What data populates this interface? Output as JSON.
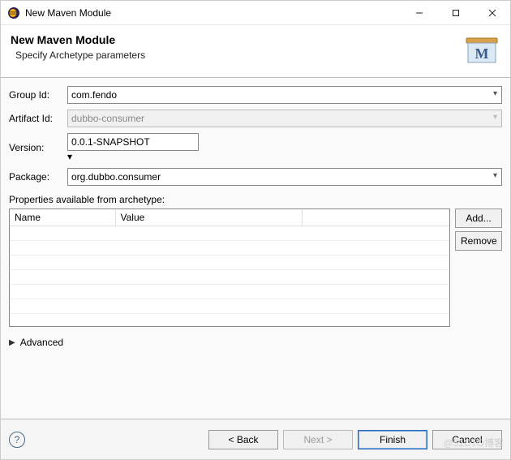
{
  "window": {
    "title": "New Maven Module"
  },
  "banner": {
    "title": "New Maven Module",
    "subtitle": "Specify Archetype parameters"
  },
  "form": {
    "labels": {
      "group_id": "Group Id:",
      "artifact_id": "Artifact Id:",
      "version": "Version:",
      "package": "Package:"
    },
    "values": {
      "group_id": "com.fendo",
      "artifact_id": "dubbo-consumer",
      "version": "0.0.1-SNAPSHOT",
      "package": "org.dubbo.consumer"
    }
  },
  "properties": {
    "label": "Properties available from archetype:",
    "columns": {
      "name": "Name",
      "value": "Value"
    },
    "rows": []
  },
  "buttons": {
    "add": "Add...",
    "remove": "Remove",
    "back": "< Back",
    "next": "Next >",
    "finish": "Finish",
    "cancel": "Cancel"
  },
  "advanced": {
    "label": "Advanced"
  },
  "watermark": "@51CTO博客"
}
